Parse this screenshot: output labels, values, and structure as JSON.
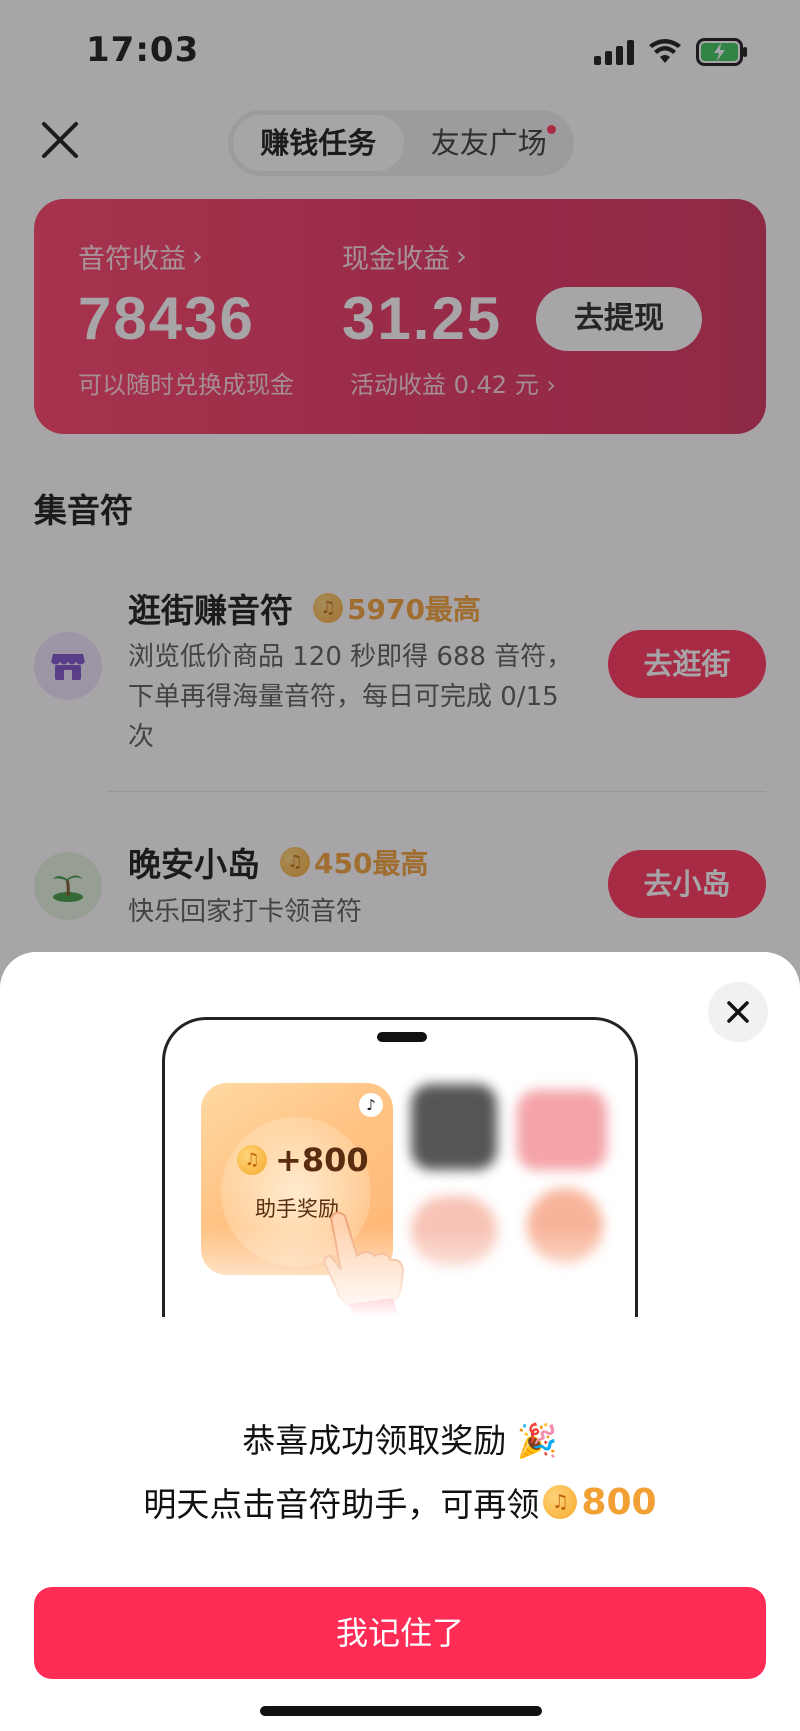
{
  "status_bar": {
    "time": "17:03"
  },
  "nav": {
    "tabs": [
      {
        "label": "赚钱任务",
        "active": true
      },
      {
        "label": "友友广场",
        "has_dot": true
      }
    ]
  },
  "earnings": {
    "notes_label": "音符收益",
    "notes_value": "78436",
    "notes_sub": "可以随时兑换成现金",
    "cash_label": "现金收益",
    "cash_value": "31.25",
    "cash_sub": "活动收益 0.42 元",
    "withdraw_label": "去提现"
  },
  "section": {
    "title": "集音符"
  },
  "tasks": [
    {
      "title": "逛街赚音符",
      "reward": "5970最高",
      "desc": "浏览低价商品 120 秒即得 688 音符，下单再得海量音符，每日可完成 0/15 次",
      "button": "去逛街",
      "icon": "shop-icon"
    },
    {
      "title": "晚安小岛",
      "reward": "450最高",
      "desc": "快乐回家打卡领音符",
      "button": "去小岛",
      "icon": "island-icon"
    }
  ],
  "sheet": {
    "widget_amount": "+800",
    "widget_label": "助手奖励",
    "congrats": "恭喜成功领取奖励 🎉",
    "next_prefix": "明天点击音符助手，可再领",
    "next_amount": "800",
    "confirm_label": "我记住了"
  },
  "colors": {
    "accent": "#ff2d55",
    "gold": "#f2a033"
  }
}
